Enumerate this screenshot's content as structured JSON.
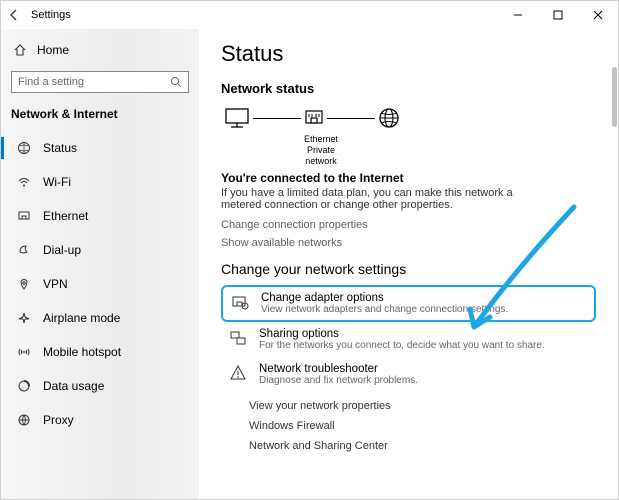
{
  "window": {
    "title": "Settings"
  },
  "sidebar": {
    "home": "Home",
    "search_placeholder": "Find a setting",
    "category": "Network & Internet",
    "items": [
      {
        "label": "Status"
      },
      {
        "label": "Wi-Fi"
      },
      {
        "label": "Ethernet"
      },
      {
        "label": "Dial-up"
      },
      {
        "label": "VPN"
      },
      {
        "label": "Airplane mode"
      },
      {
        "label": "Mobile hotspot"
      },
      {
        "label": "Data usage"
      },
      {
        "label": "Proxy"
      }
    ]
  },
  "main": {
    "title": "Status",
    "net_status_heading": "Network status",
    "diagram": {
      "eth_label": "Ethernet",
      "eth_sub": "Private network"
    },
    "connected_heading": "You're connected to the Internet",
    "connected_body": "If you have a limited data plan, you can make this network a metered connection or change other properties.",
    "change_conn_props": "Change connection properties",
    "show_avail": "Show available networks",
    "change_settings_heading": "Change your network settings",
    "options": [
      {
        "title": "Change adapter options",
        "sub": "View network adapters and change connection settings."
      },
      {
        "title": "Sharing options",
        "sub": "For the networks you connect to, decide what you want to share."
      },
      {
        "title": "Network troubleshooter",
        "sub": "Diagnose and fix network problems."
      }
    ],
    "links": [
      "View your network properties",
      "Windows Firewall",
      "Network and Sharing Center"
    ]
  }
}
